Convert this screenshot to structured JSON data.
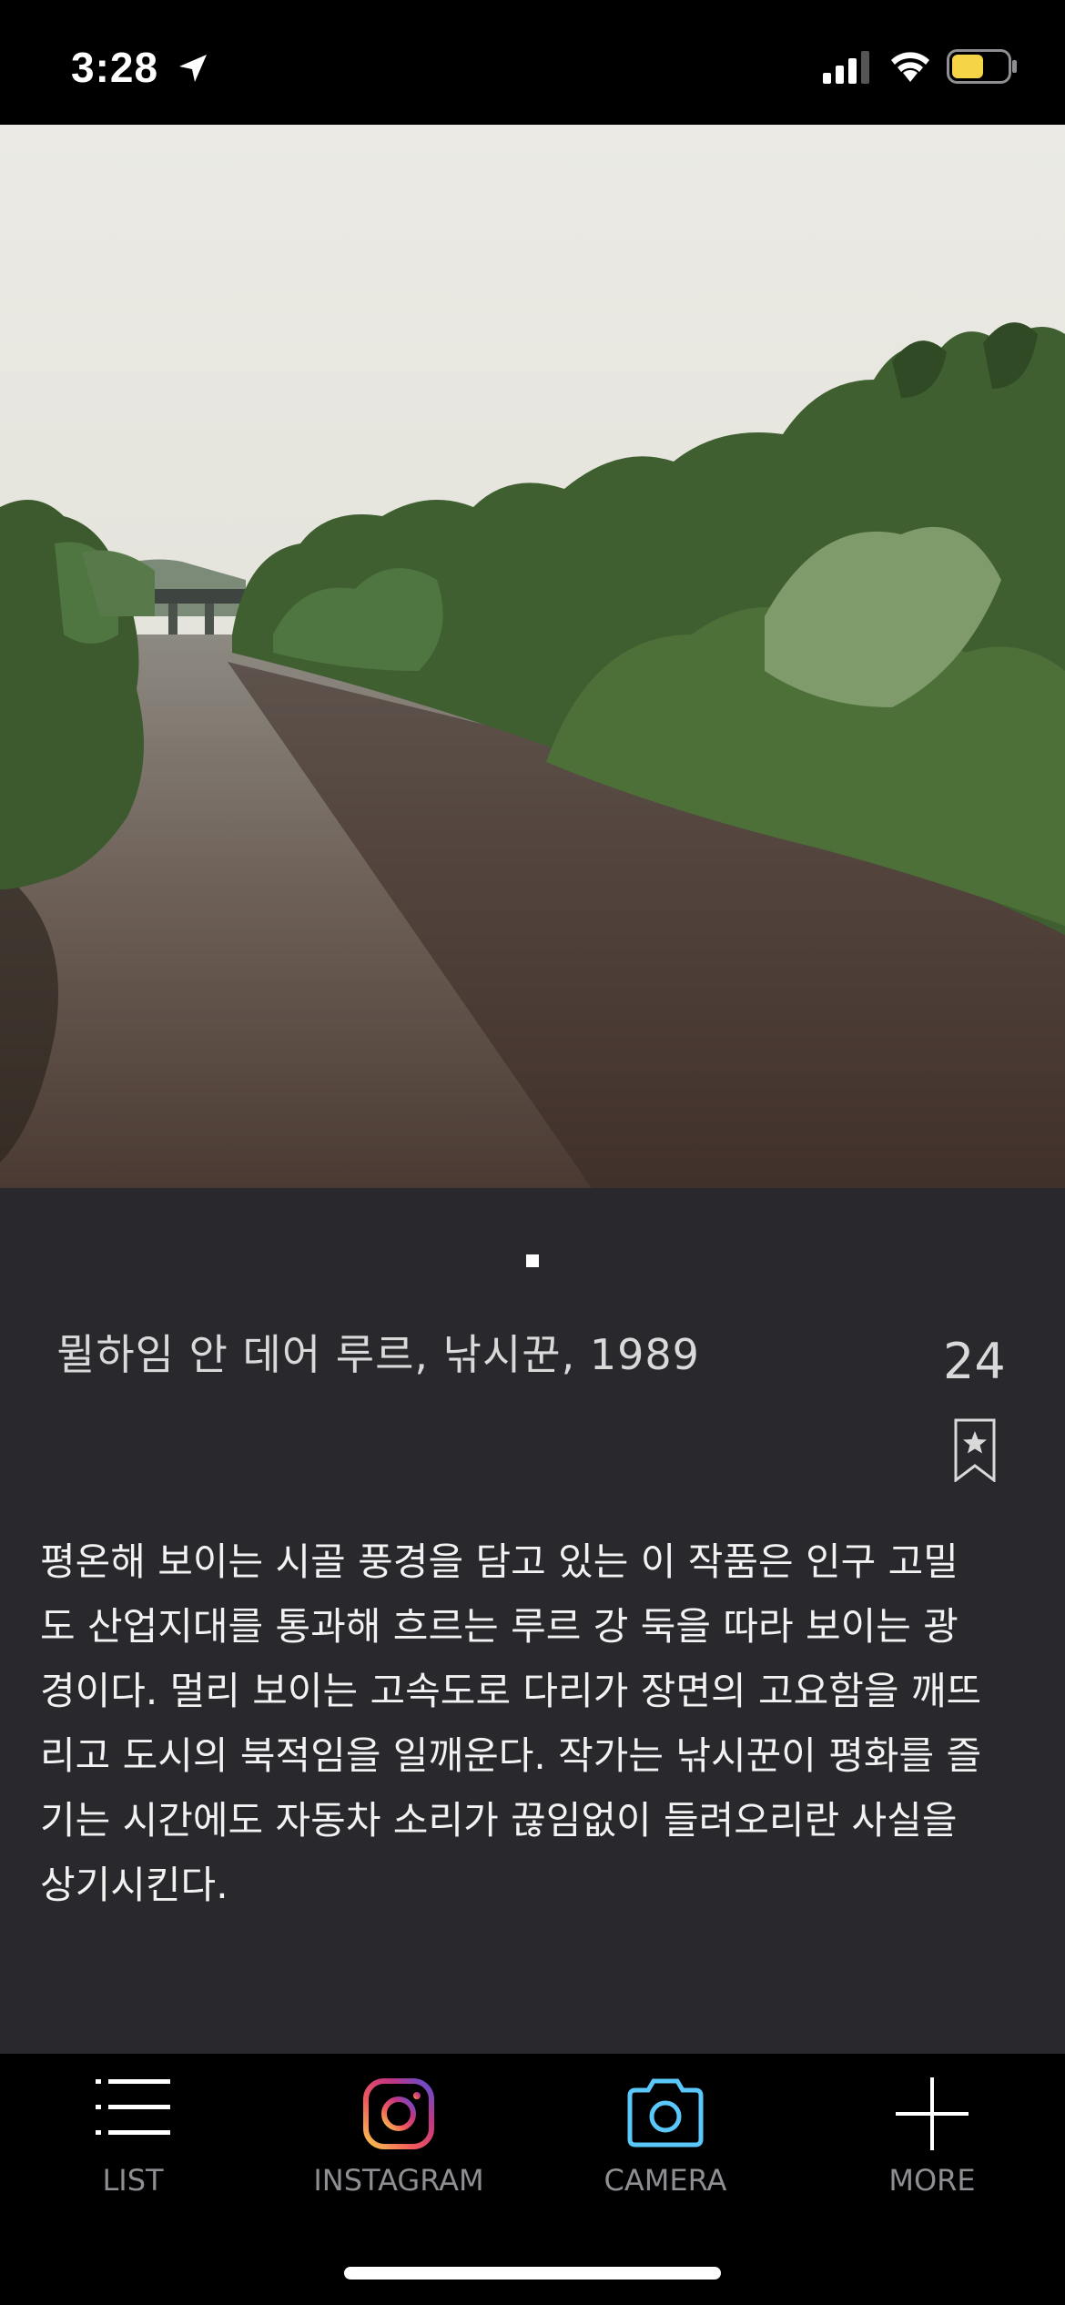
{
  "status_bar": {
    "time": "3:28"
  },
  "artwork": {
    "caption": "뮐하임 안 데어 루르, 낚시꾼, 1989",
    "count": "24",
    "description": "평온해 보이는 시골 풍경을 담고 있는 이 작품은 인구 고밀도 산업지대를 통과해 흐르는 루르 강 둑을 따라 보이는 광경이다. 멀리 보이는 고속도로 다리가 장면의 고요함을 깨뜨리고 도시의 북적임을 일깨운다. 작가는 낚시꾼이 평화를 즐기는 시간에도 자동차 소리가 끊임없이 들려오리란 사실을 상기시킨다."
  },
  "tab_bar": {
    "list": "LIST",
    "instagram": "INSTAGRAM",
    "camera": "CAMERA",
    "more": "MORE"
  },
  "colors": {
    "background": "#29282d",
    "battery": "#f5d547",
    "camera_icon": "#5ac8fa"
  }
}
